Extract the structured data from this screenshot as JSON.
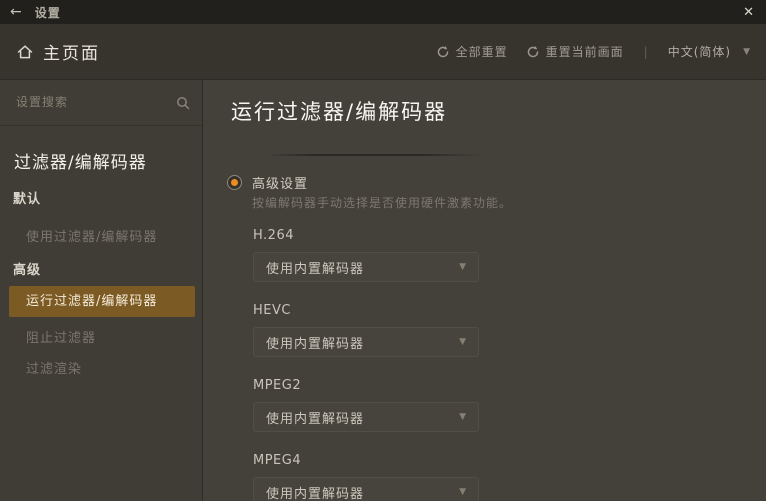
{
  "icons": {
    "back": "←",
    "close": "✕",
    "caret_down": "▼",
    "separator": "|"
  },
  "titlebar": {
    "title": "设置"
  },
  "header": {
    "page_title": "主页面",
    "reset_all_label": "全部重置",
    "reset_current_label": "重置当前画面",
    "language": "中文(简体)"
  },
  "sidebar": {
    "search_placeholder": "设置搜索",
    "section_title": "过滤器/编解码器",
    "groups": [
      {
        "label": "默认",
        "items": [
          {
            "label": "使用过滤器/编解码器",
            "selected": false
          }
        ]
      },
      {
        "label": "高级",
        "items": [
          {
            "label": "运行过滤器/编解码器",
            "selected": true
          },
          {
            "label": "阻止过滤器",
            "selected": false
          },
          {
            "label": "过滤渲染",
            "selected": false
          }
        ]
      }
    ]
  },
  "main": {
    "title": "运行过滤器/编解码器",
    "radio": {
      "label": "高级设置",
      "selected": true
    },
    "description": "按编解码器手动选择是否使用硬件激素功能。",
    "codec_sections": [
      {
        "label": "H.264",
        "value": "使用内置解码器"
      },
      {
        "label": "HEVC",
        "value": "使用内置解码器"
      },
      {
        "label": "MPEG2",
        "value": "使用内置解码器"
      },
      {
        "label": "MPEG4",
        "value": "使用内置解码器"
      }
    ]
  },
  "colors": {
    "accent_orange": "#ef8c1f",
    "selected_item_bg": "#7b5a23",
    "titlebar_bg": "#21201d",
    "header_bg": "#37342e",
    "sidebar_bg": "#403d36",
    "main_bg": "#44413a"
  }
}
